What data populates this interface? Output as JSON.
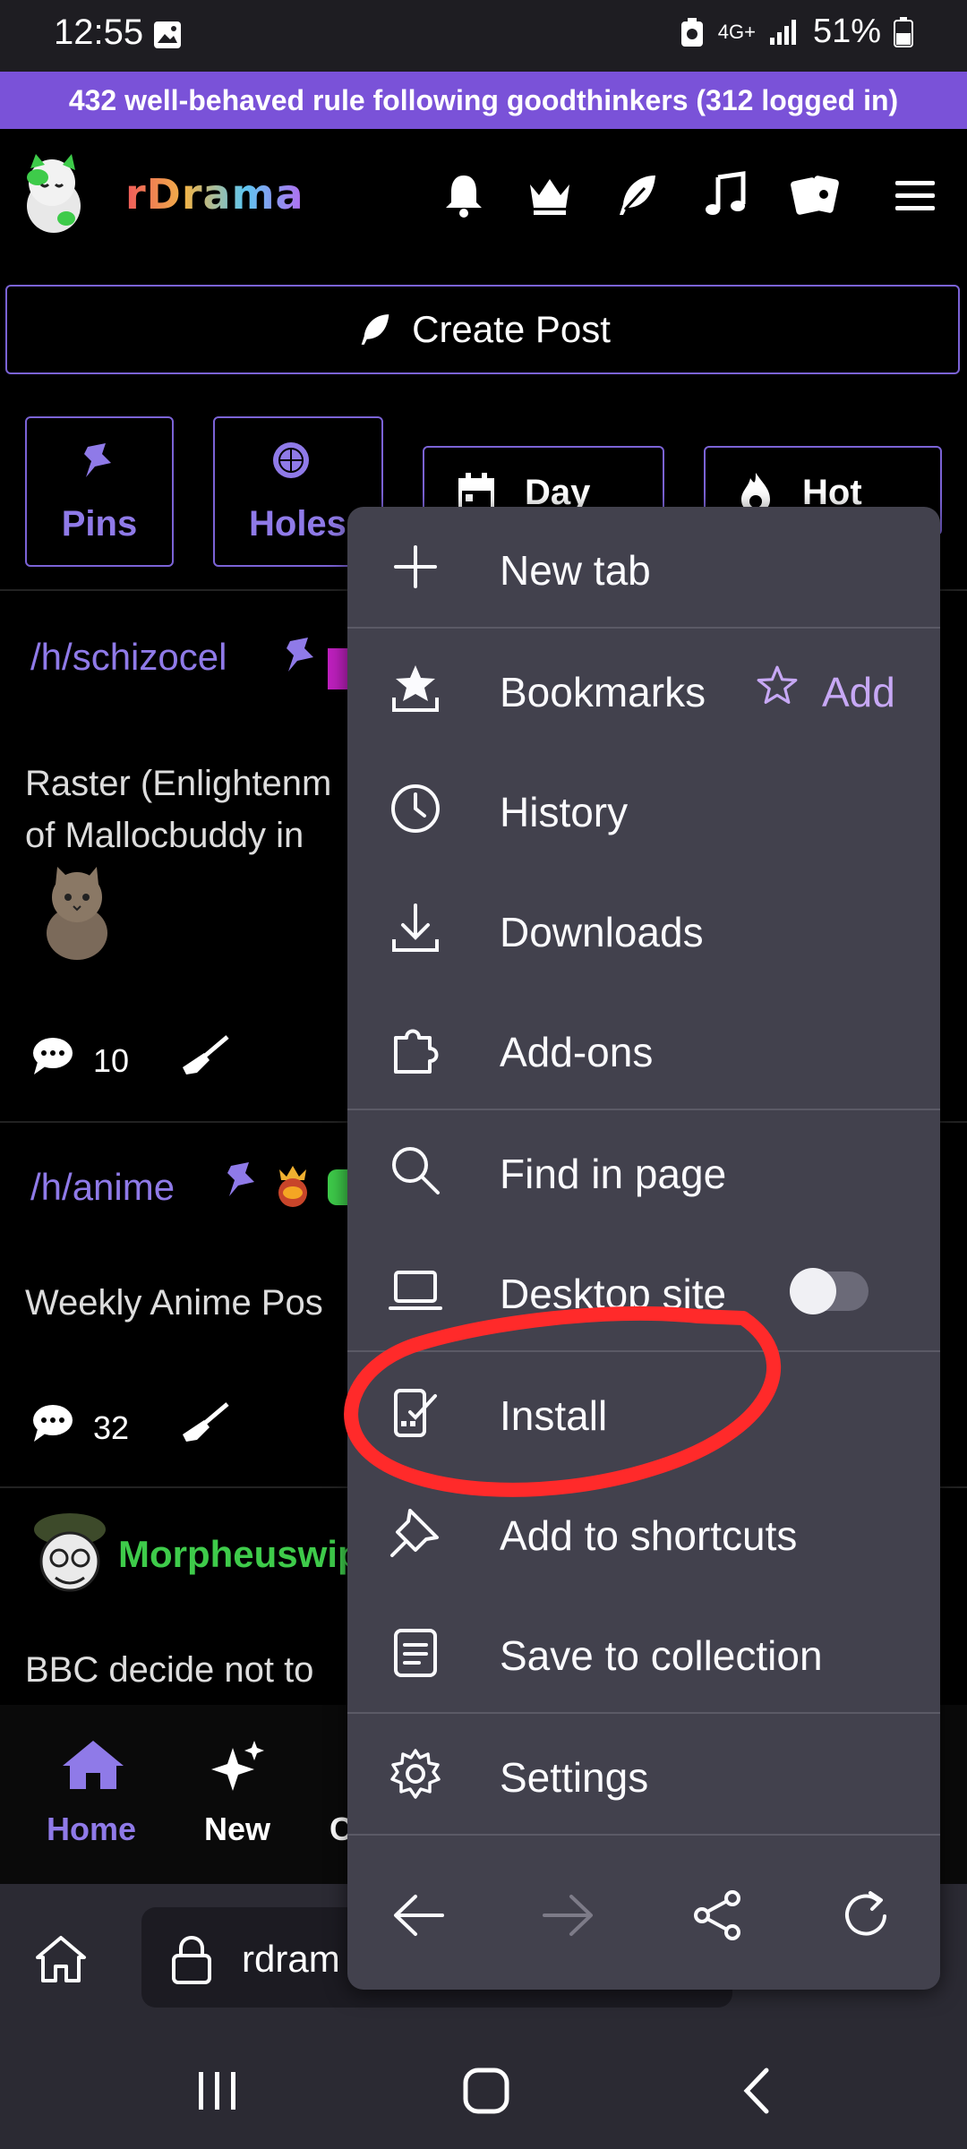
{
  "status_bar": {
    "time": "12:55",
    "network": "4G+",
    "battery": "51%"
  },
  "banner": {
    "text": "432 well-behaved rule following goodthinkers (312 logged in)"
  },
  "site": {
    "name": "rDrama",
    "create_post_label": "Create Post"
  },
  "filters": {
    "pins": "Pins",
    "holes": "Holes",
    "day": "Day",
    "hot": "Hot"
  },
  "posts": [
    {
      "hole": "/h/schizocel",
      "text_line1": "Raster (Enlightenm",
      "text_line2": "of Mallocbuddy in ",
      "comments": "10"
    },
    {
      "hole": "/h/anime",
      "text_line1": "Weekly Anime Pos",
      "comments": "32"
    },
    {
      "author": "Morpheuswip",
      "text_line1": "BBC decide not to "
    }
  ],
  "site_nav": {
    "home": "Home",
    "new": "New",
    "partial": "C"
  },
  "browser": {
    "url": "rdram"
  },
  "menu": {
    "new_tab": "New tab",
    "bookmarks": "Bookmarks",
    "add_bookmark": "Add",
    "history": "History",
    "downloads": "Downloads",
    "addons": "Add-ons",
    "find_in_page": "Find in page",
    "desktop_site": "Desktop site",
    "desktop_site_enabled": false,
    "install": "Install",
    "add_to_shortcuts": "Add to shortcuts",
    "save_to_collection": "Save to collection",
    "settings": "Settings"
  },
  "colors": {
    "accent": "#7a52d8",
    "menu_bg": "#42414d",
    "annotation": "#ff2a2a",
    "author_green": "#3ecb4a"
  }
}
